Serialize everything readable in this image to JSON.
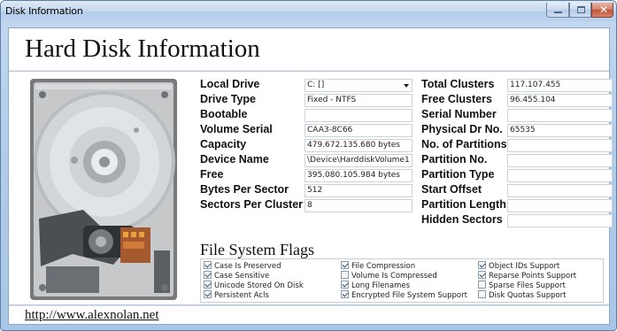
{
  "window": {
    "title": "Disk Information"
  },
  "header": {
    "title": "Hard Disk Information"
  },
  "left_fields": [
    {
      "label": "Local Drive",
      "value": "C: []"
    },
    {
      "label": "Drive Type",
      "value": "Fixed - NTFS"
    },
    {
      "label": "Bootable",
      "value": ""
    },
    {
      "label": "Volume Serial",
      "value": "CAA3-8C66"
    },
    {
      "label": "Capacity",
      "value": "479.672.135.680 bytes"
    },
    {
      "label": "Device Name",
      "value": "\\Device\\HarddiskVolume1"
    },
    {
      "label": "Free",
      "value": "395.080.105.984 bytes"
    },
    {
      "label": "Bytes Per Sector",
      "value": "512"
    },
    {
      "label": "Sectors Per Cluster",
      "value": "8"
    }
  ],
  "right_fields": [
    {
      "label": "Total Clusters",
      "value": "117.107.455"
    },
    {
      "label": "Free Clusters",
      "value": "96.455.104"
    },
    {
      "label": "Serial Number",
      "value": ""
    },
    {
      "label": "Physical Dr No.",
      "value": "65535"
    },
    {
      "label": "No. of Partitions",
      "value": ""
    },
    {
      "label": "Partition No.",
      "value": ""
    },
    {
      "label": "Partition Type",
      "value": ""
    },
    {
      "label": "Start Offset",
      "value": ""
    },
    {
      "label": "Partition Length",
      "value": ""
    },
    {
      "label": "Hidden Sectors",
      "value": ""
    }
  ],
  "flags": {
    "title": "File System Flags",
    "items": [
      {
        "label": "Case Is Preserved",
        "checked": true
      },
      {
        "label": "Case Sensitive",
        "checked": true
      },
      {
        "label": "Unicode Stored On Disk",
        "checked": true
      },
      {
        "label": "Persistent Acls",
        "checked": true
      },
      {
        "label": "File Compression",
        "checked": true
      },
      {
        "label": "Volume Is Compressed",
        "checked": false
      },
      {
        "label": "Long Filenames",
        "checked": true
      },
      {
        "label": "Encrypted File System Support",
        "checked": true
      },
      {
        "label": "Object IDs Support",
        "checked": true
      },
      {
        "label": "Reparse Points Support",
        "checked": true
      },
      {
        "label": "Sparse Files Support",
        "checked": false
      },
      {
        "label": "Disk Quotas Support",
        "checked": false
      }
    ]
  },
  "footer": {
    "link": "http://www.alexnolan.net"
  },
  "icons": {
    "close": "close-icon",
    "minimize": "minimize-icon",
    "maximize": "maximize-icon",
    "disk": "hard-disk-image"
  }
}
